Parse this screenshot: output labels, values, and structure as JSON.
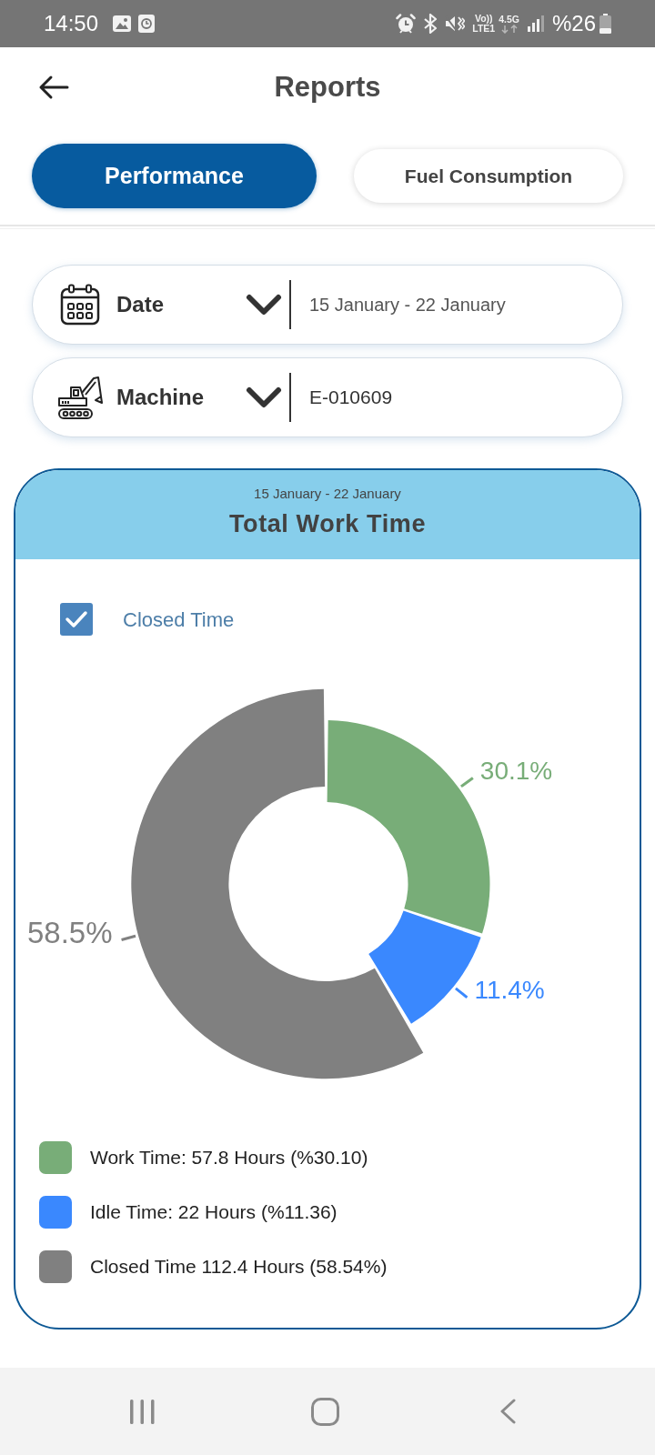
{
  "status_bar": {
    "time": "14:50",
    "volte_label": "Vo))",
    "lte_label": "LTE1",
    "network_type": "4.5G",
    "battery": "%26"
  },
  "header": {
    "title": "Reports"
  },
  "tabs": [
    {
      "label": "Performance",
      "selected": true
    },
    {
      "label": "Fuel Consumption",
      "selected": false
    }
  ],
  "filters": [
    {
      "kind": "date",
      "label": "Date",
      "value": "15 January - 22 January"
    },
    {
      "kind": "machine",
      "label": "Machine",
      "value": "E-010609"
    }
  ],
  "report_card": {
    "subtitle": "15 January - 22 January",
    "title": "Total Work Time",
    "checkbox": {
      "label": "Closed Time",
      "checked": true
    },
    "chart_data": {
      "type": "donut",
      "values": [
        30.1,
        11.4,
        58.5
      ],
      "value_labels": [
        "30.1%",
        "11.4%",
        "58.5%"
      ]
    },
    "legend": [
      {
        "label": "Work Time: 57.8 Hours (%30.10)",
        "color": "#78ad78",
        "selected": false
      },
      {
        "label": "Idle Time: 22 Hours (%11.36)",
        "color": "#3a88fe",
        "selected": false
      },
      {
        "label": "Closed Time 112.4 Hours (58.54%)",
        "color": "#808080",
        "selected": true
      }
    ]
  }
}
